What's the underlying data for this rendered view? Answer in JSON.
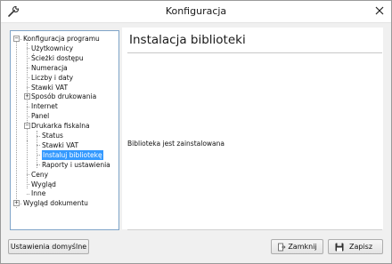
{
  "window": {
    "title": "Konfiguracja"
  },
  "tree": [
    {
      "label": "Konfiguracja programu",
      "expander": "−",
      "level": 0
    },
    {
      "label": "Użytkownicy",
      "level": 1
    },
    {
      "label": "Ścieżki dostępu",
      "level": 1
    },
    {
      "label": "Numeracja",
      "level": 1
    },
    {
      "label": "Liczby i daty",
      "level": 1
    },
    {
      "label": "Stawki VAT",
      "level": 1
    },
    {
      "label": "Sposób drukowania",
      "expander": "+",
      "level": 1
    },
    {
      "label": "Internet",
      "level": 1
    },
    {
      "label": "Panel",
      "level": 1
    },
    {
      "label": "Drukarka fiskalna",
      "expander": "−",
      "level": 1
    },
    {
      "label": "Status",
      "level": 2
    },
    {
      "label": "Stawki VAT",
      "level": 2
    },
    {
      "label": "Instaluj bibliotekę",
      "level": 2,
      "selected": true
    },
    {
      "label": "Raporty i ustawienia",
      "level": 2
    },
    {
      "label": "Ceny",
      "level": 1
    },
    {
      "label": "Wygląd",
      "level": 1
    },
    {
      "label": "Inne",
      "level": 1
    },
    {
      "label": "Wygląd dokumentu",
      "expander": "+",
      "level": 0
    }
  ],
  "panel": {
    "title": "Instalacja biblioteki",
    "status": "Biblioteka jest zainstalowana"
  },
  "buttons": {
    "defaults": "Ustawienia domyślne",
    "close": "Zamknij",
    "save": "Zapisz"
  },
  "colors": {
    "selection": "#3399ff",
    "tree_border": "#7fa4c8"
  },
  "icons": {
    "app": "wrench-icon",
    "close": "close-icon",
    "close_button": "door-exit-icon",
    "save_button": "floppy-disk-icon"
  }
}
